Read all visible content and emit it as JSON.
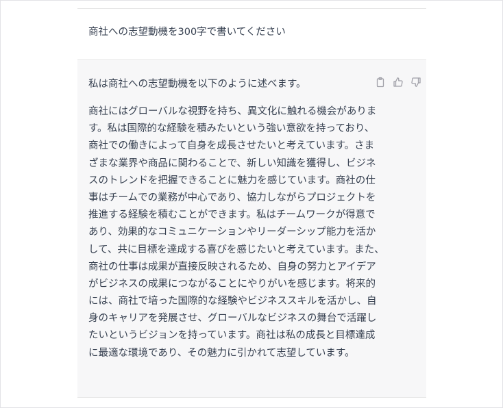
{
  "conversation": {
    "user_message": "商社への志望動機を300字で書いてください",
    "assistant_intro": "私は商社への志望動機を以下のように述べます。",
    "assistant_lines": [
      "商社にはグローバルな視野を持ち、異文化に触れる機会がありま",
      "す。私は国際的な経験を積みたいという強い意欲を持っており、",
      "商社での働きによって自身を成長させたいと考えています。さま",
      "ざまな業界や商品に関わることで、新しい知識を獲得し、ビジネ",
      "スのトレンドを把握できることに魅力を感じています。商社の仕",
      "事はチームでの業務が中心であり、協力しながらプロジェクトを",
      "推進する経験を積むことができます。私はチームワークが得意で",
      "あり、効果的なコミュニケーションやリーダーシップ能力を活か",
      "して、共に目標を達成する喜びを感じたいと考えています。また、",
      "商社の仕事は成果が直接反映されるため、自身の努力とアイデア",
      "がビジネスの成果につながることにやりがいを感じます。将来的",
      "には、商社で培った国際的な経験やビジネススキルを活かし、自",
      "身のキャリアを発展させ、グローバルなビジネスの舞台で活躍し",
      "たいというビジョンを持っています。商社は私の成長と目標達成",
      "に最適な環境であり、その魅力に引かれて志望しています。"
    ]
  },
  "actions": {
    "copy_icon": "clipboard-icon",
    "like_icon": "thumbs-up-icon",
    "dislike_icon": "thumbs-down-icon"
  },
  "colors": {
    "text": "#374151",
    "assistant_bg": "#f7f7f8",
    "icon": "#a0a0a8"
  }
}
